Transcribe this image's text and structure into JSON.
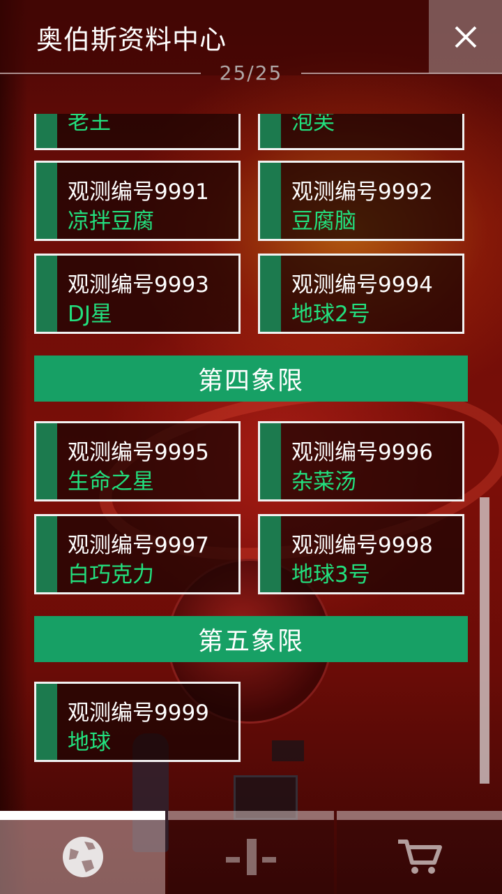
{
  "header": {
    "title": "奥伯斯资料中心",
    "page_counter": "25/25"
  },
  "cards": [
    {
      "num": "",
      "name": "老王",
      "partial": true
    },
    {
      "num": "",
      "name": "泡芙",
      "partial": true
    },
    {
      "num": "观测编号9991",
      "name": "凉拌豆腐"
    },
    {
      "num": "观测编号9992",
      "name": "豆腐脑"
    },
    {
      "num": "观测编号9993",
      "name": "DJ星"
    },
    {
      "num": "观测编号9994",
      "name": "地球2号"
    },
    {
      "num": "观测编号9995",
      "name": "生命之星"
    },
    {
      "num": "观测编号9996",
      "name": "杂菜汤"
    },
    {
      "num": "观测编号9997",
      "name": "白巧克力"
    },
    {
      "num": "观测编号9998",
      "name": "地球3号"
    },
    {
      "num": "观测编号9999",
      "name": "地球"
    }
  ],
  "sections": [
    "第四象限",
    "第五象限"
  ],
  "bottom_nav": {
    "active_index": 0,
    "tabs": [
      {
        "icon": "planet-icon"
      },
      {
        "icon": "observatory-icon"
      },
      {
        "icon": "cart-icon"
      }
    ]
  },
  "colors": {
    "accent_green": "#17a065",
    "card_strip": "#1c7a4e",
    "name_text": "#22e07e"
  }
}
